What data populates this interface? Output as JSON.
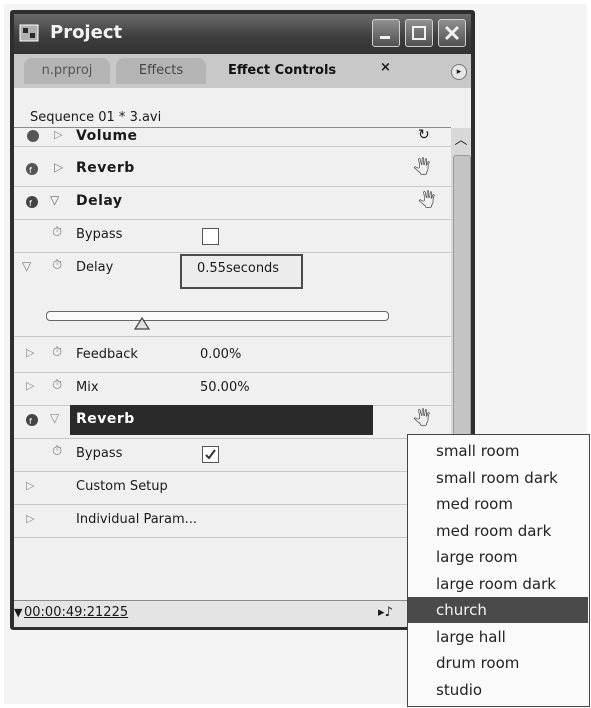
{
  "window": {
    "title": "Project",
    "tabs": [
      {
        "label": "n.prproj"
      },
      {
        "label": "Effects"
      },
      {
        "label": "Effect Controls",
        "close": "×"
      }
    ]
  },
  "panel": {
    "sequence_label": "Sequence 01 * 3.avi",
    "effects": {
      "volume": "Volume",
      "reverb1": "Reverb",
      "delay": {
        "name": "Delay",
        "bypass_label": "Bypass",
        "delay_label": "Delay",
        "delay_value": "0.55seconds",
        "slider_level": 0.28,
        "feedback_label": "Feedback",
        "feedback_value": "0.00%",
        "mix_label": "Mix",
        "mix_value": "50.00%"
      },
      "reverb2": {
        "name": "Reverb",
        "bypass_label": "Bypass",
        "bypass_checked": true,
        "custom_setup": "Custom Setup",
        "individual_params": "Individual Param..."
      }
    },
    "timecode": "00:00:49:21225"
  },
  "dropdown": {
    "options": [
      "small room",
      "small room dark",
      "med room",
      "med room dark",
      "large room",
      "large room dark",
      "church",
      "large hall",
      "drum room",
      "studio"
    ],
    "selected": "church"
  }
}
